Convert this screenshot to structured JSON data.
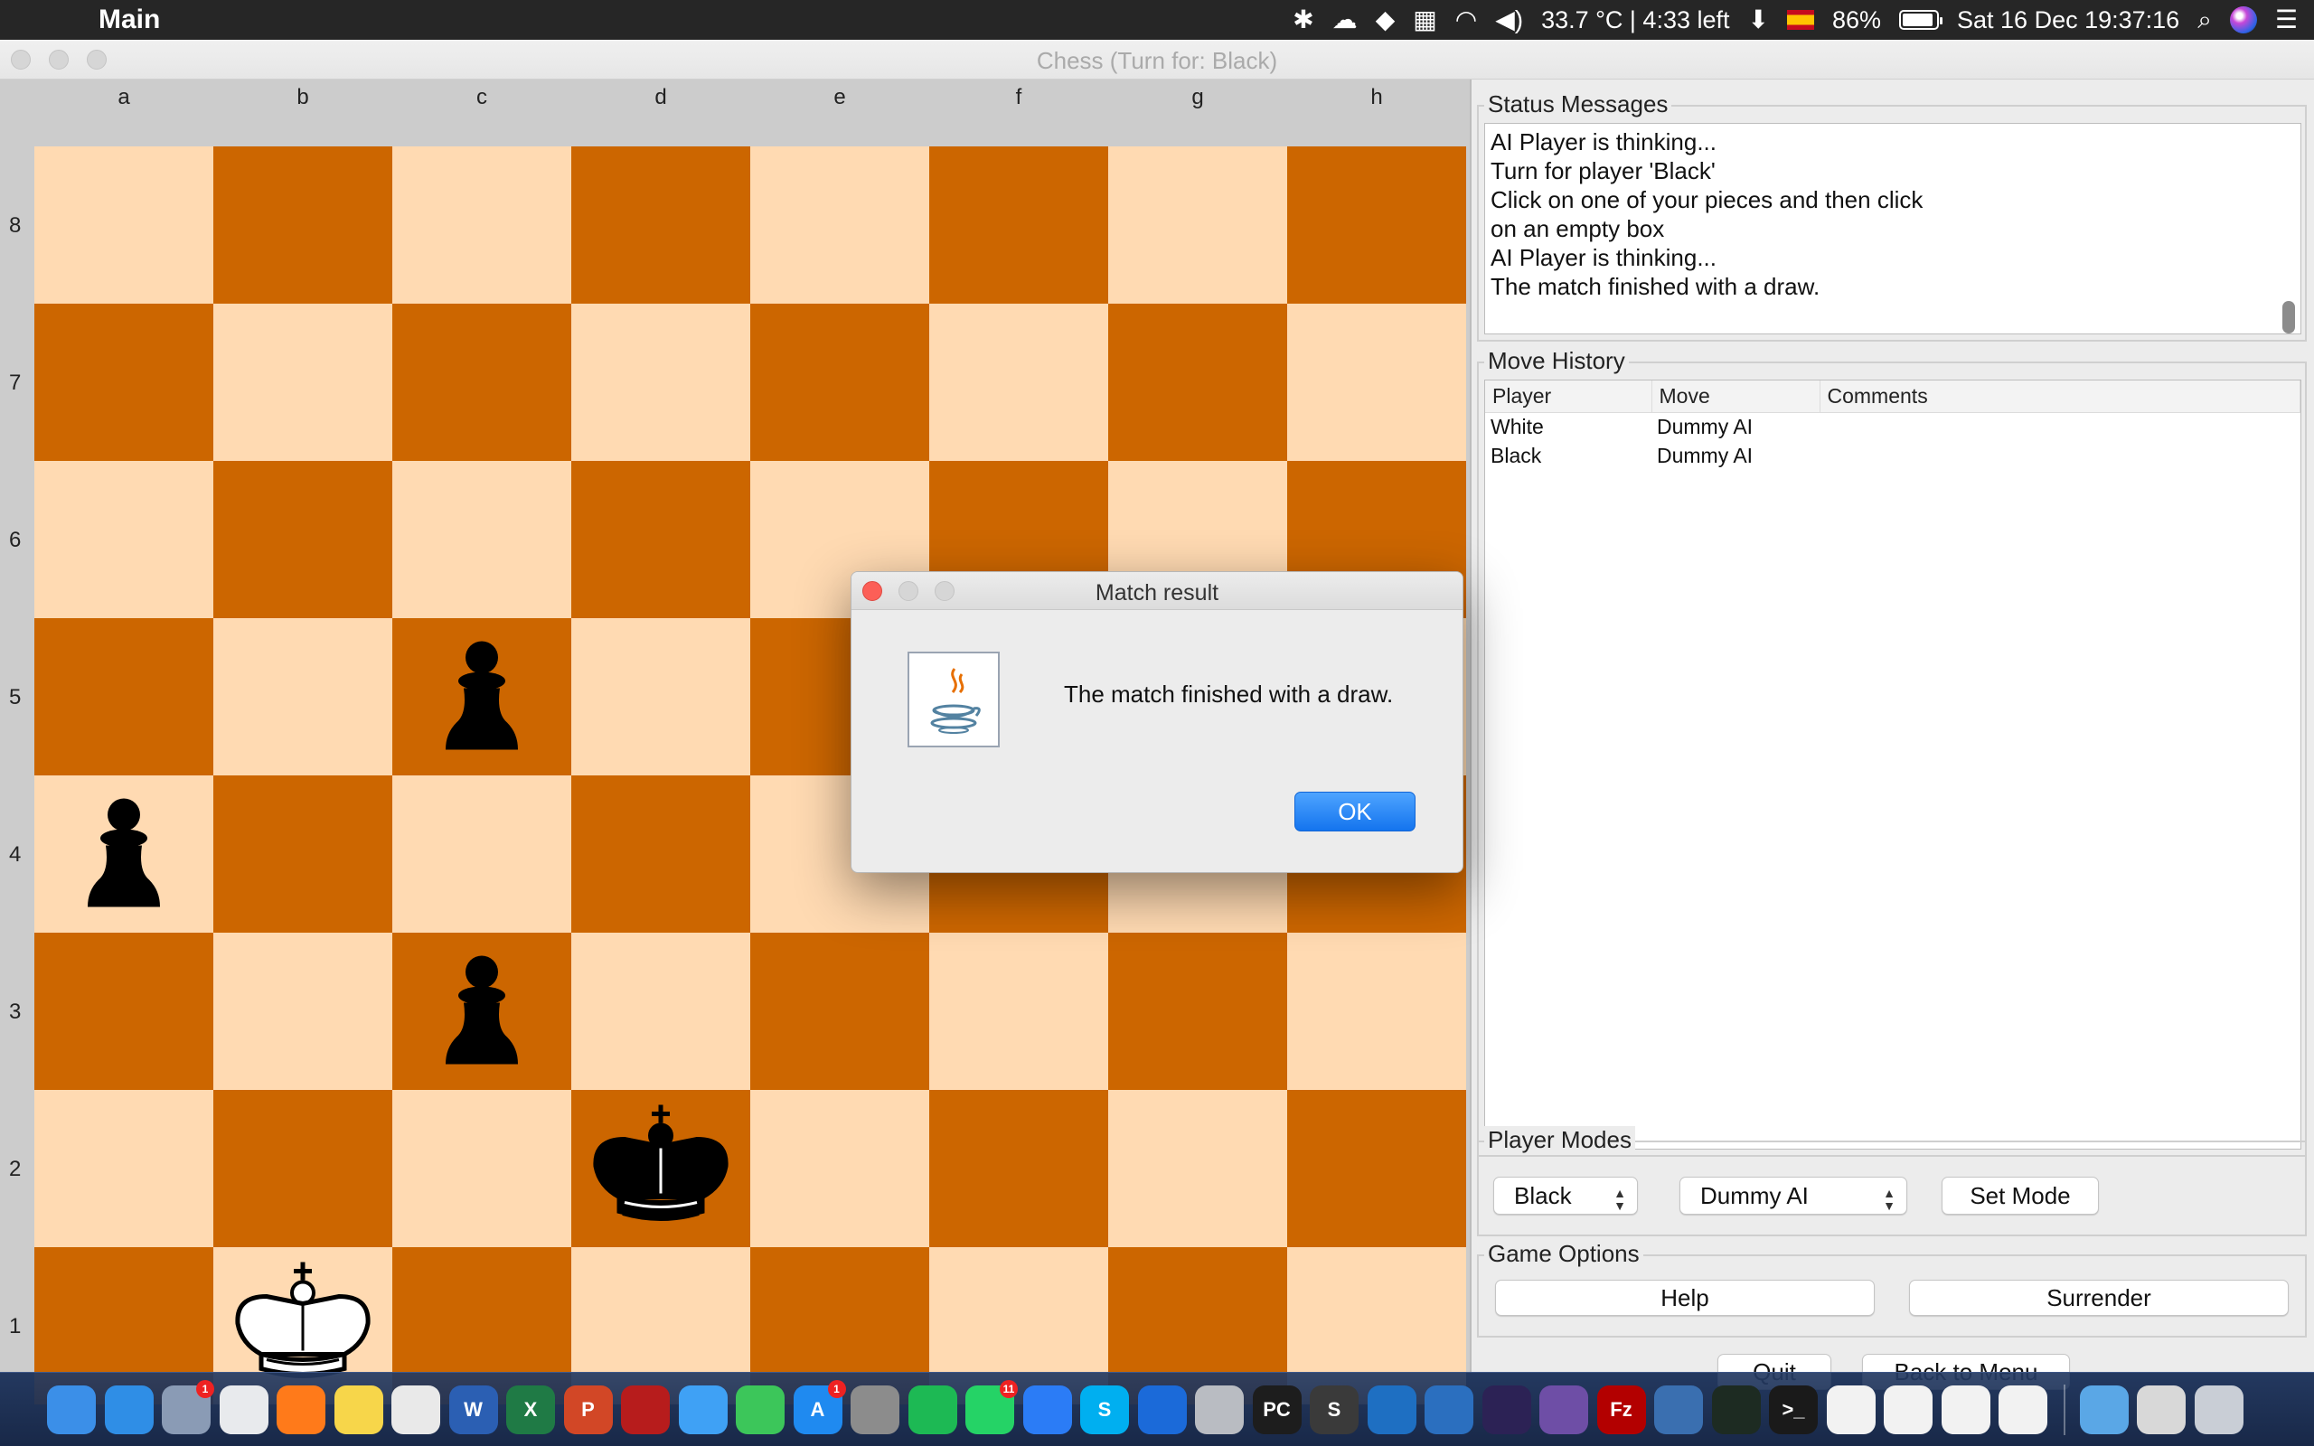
{
  "menubar": {
    "app_name": "Main",
    "temp_time": "33.7 °C | 4:33 left",
    "battery_percent": "86%",
    "datetime": "Sat 16 Dec  19:37:16"
  },
  "window": {
    "title": "Chess (Turn for: Black)"
  },
  "board": {
    "files": [
      "a",
      "b",
      "c",
      "d",
      "e",
      "f",
      "g",
      "h"
    ],
    "ranks": [
      "8",
      "7",
      "6",
      "5",
      "4",
      "3",
      "2",
      "1"
    ],
    "colors": {
      "light": "#ffdab2",
      "dark": "#cc6600"
    },
    "pieces": [
      {
        "square": "c5",
        "type": "pawn",
        "color": "black"
      },
      {
        "square": "a4",
        "type": "pawn",
        "color": "black"
      },
      {
        "square": "c3",
        "type": "pawn",
        "color": "black"
      },
      {
        "square": "d2",
        "type": "king",
        "color": "black"
      },
      {
        "square": "b1",
        "type": "king",
        "color": "white"
      }
    ]
  },
  "status": {
    "title": "Status Messages",
    "partial_line": "- - -",
    "lines": [
      "AI Player is thinking...",
      "Turn for player 'Black'",
      "Click on one of your pieces and then click",
      "on an empty box",
      "AI Player is thinking...",
      "The match finished with a draw."
    ]
  },
  "history": {
    "title": "Move History",
    "columns": [
      "Player",
      "Move",
      "Comments"
    ],
    "rows": [
      [
        "White",
        "Dummy AI",
        ""
      ],
      [
        "Black",
        "Dummy AI",
        ""
      ]
    ]
  },
  "modes": {
    "title": "Player Modes",
    "player_select": "Black",
    "mode_select": "Dummy AI",
    "set_mode": "Set Mode"
  },
  "options": {
    "title": "Game Options",
    "help": "Help",
    "surrender": "Surrender"
  },
  "footer": {
    "quit": "Quit",
    "back": "Back to Menu"
  },
  "dialog": {
    "title": "Match result",
    "message": "The match finished with a draw.",
    "ok": "OK"
  },
  "dock": {
    "items": [
      {
        "name": "finder",
        "label": "",
        "color": "#3b8fe8"
      },
      {
        "name": "safari",
        "label": "",
        "color": "#2f8ee6"
      },
      {
        "name": "mail",
        "label": "",
        "color": "#8a9bb5",
        "badge": "1"
      },
      {
        "name": "chrome",
        "label": "",
        "color": "#e8eaed"
      },
      {
        "name": "firefox",
        "label": "",
        "color": "#ff7a1a"
      },
      {
        "name": "notes",
        "label": "",
        "color": "#f7d64a"
      },
      {
        "name": "textedit",
        "label": "",
        "color": "#e9e9e9"
      },
      {
        "name": "word",
        "label": "W",
        "color": "#2b5fb3"
      },
      {
        "name": "excel",
        "label": "X",
        "color": "#1f7a45"
      },
      {
        "name": "powerpoint",
        "label": "P",
        "color": "#d24726"
      },
      {
        "name": "acrobat",
        "label": "",
        "color": "#b71c1c"
      },
      {
        "name": "messages",
        "label": "",
        "color": "#3fa1f5"
      },
      {
        "name": "facetime",
        "label": "",
        "color": "#3cc65a"
      },
      {
        "name": "app-store",
        "label": "A",
        "color": "#1f8af0",
        "badge": "1"
      },
      {
        "name": "system-preferences",
        "label": "",
        "color": "#8c8c8c"
      },
      {
        "name": "spotify",
        "label": "",
        "color": "#1db954"
      },
      {
        "name": "whatsapp",
        "label": "",
        "color": "#25d366",
        "badge": "11"
      },
      {
        "name": "messenger",
        "label": "",
        "color": "#2b7cf6"
      },
      {
        "name": "skype",
        "label": "S",
        "color": "#00aff0"
      },
      {
        "name": "teamviewer",
        "label": "",
        "color": "#1b6ad9"
      },
      {
        "name": "settings-app",
        "label": "",
        "color": "#b9bcc2"
      },
      {
        "name": "pycharm",
        "label": "PC",
        "color": "#1d1d1d"
      },
      {
        "name": "sublime",
        "label": "S",
        "color": "#3a3a3a"
      },
      {
        "name": "vscode",
        "label": "",
        "color": "#1e6fc2"
      },
      {
        "name": "xcode",
        "label": "",
        "color": "#2b6fbf"
      },
      {
        "name": "eclipse",
        "label": "",
        "color": "#2c2255"
      },
      {
        "name": "github",
        "label": "",
        "color": "#6e4ea6"
      },
      {
        "name": "filezilla",
        "label": "Fz",
        "color": "#b30000"
      },
      {
        "name": "virtualbox",
        "label": "",
        "color": "#3a6fb0"
      },
      {
        "name": "activity-monitor",
        "label": "",
        "color": "#1d2b22"
      },
      {
        "name": "terminal",
        "label": ">_",
        "color": "#1a1a1a"
      },
      {
        "name": "java-app-1",
        "label": "",
        "color": "#f2f2f2"
      },
      {
        "name": "java-app-2",
        "label": "",
        "color": "#f2f2f2"
      },
      {
        "name": "java-app-3",
        "label": "",
        "color": "#f2f2f2"
      },
      {
        "name": "java-app-4",
        "label": "",
        "color": "#f2f2f2"
      }
    ],
    "trailing": [
      {
        "name": "folder-stack",
        "label": "",
        "color": "#5aa7e6"
      },
      {
        "name": "documents-stack",
        "label": "",
        "color": "#d8d8d8"
      },
      {
        "name": "trash",
        "label": "",
        "color": "#c9ced6"
      }
    ]
  }
}
